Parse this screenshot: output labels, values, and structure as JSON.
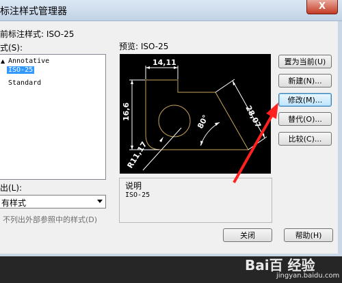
{
  "window": {
    "title": "标注样式管理器",
    "close_glyph": "X"
  },
  "current_style": {
    "label": "前标注样式: ISO-25"
  },
  "styles": {
    "label": "式(S):",
    "items": [
      {
        "label": "Annotative",
        "selected": false
      },
      {
        "label": "ISO-25",
        "selected": true
      },
      {
        "label": "Standard",
        "selected": false
      }
    ]
  },
  "preview": {
    "label": "预览: ISO-25",
    "dims": {
      "top": "14,11",
      "left": "16,6",
      "right": "28,07",
      "angle": "80°",
      "radius": "R11,17"
    }
  },
  "list_filter": {
    "label": "出(L):",
    "value": "有样式"
  },
  "external_refs": {
    "label": "不列出外部参照中的样式(D)"
  },
  "description": {
    "title": "说明",
    "text": "ISO-25"
  },
  "buttons": {
    "set_current": "置为当前(U)",
    "new": "新建(N)...",
    "modify": "修改(M)...",
    "override": "替代(O)...",
    "compare": "比较(C)...",
    "close": "关闭",
    "help": "帮助(H)"
  },
  "watermark": {
    "brand": "Bai百 经验",
    "url": "jingyan.baidu.com"
  },
  "colors": {
    "preview_bg": "#000000",
    "shape": "#c8a65a",
    "dimension": "#ffffff",
    "arrow": "#ff2020",
    "selection": "#3399ff"
  }
}
